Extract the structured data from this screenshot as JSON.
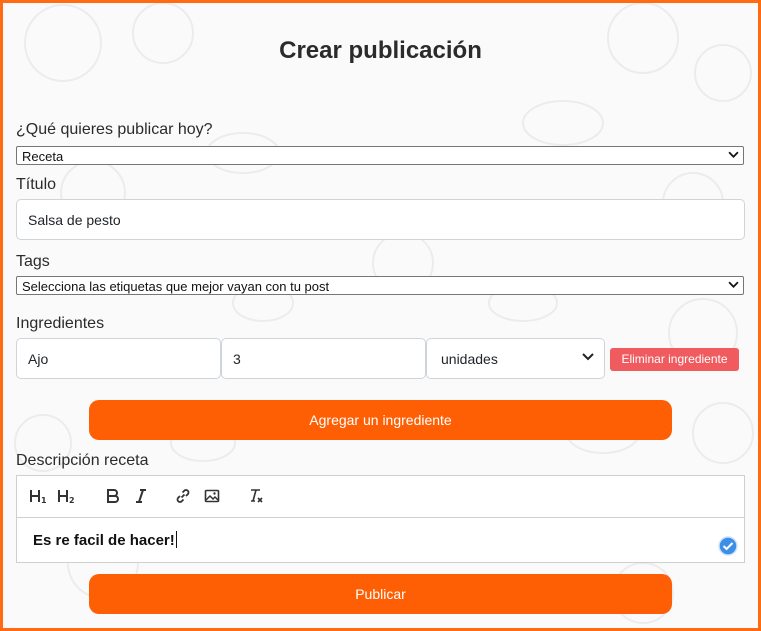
{
  "page": {
    "title": "Crear publicación"
  },
  "post_type": {
    "label": "¿Qué quieres publicar hoy?",
    "selected": "Receta"
  },
  "title_field": {
    "label": "Título",
    "value": "Salsa de pesto"
  },
  "tags": {
    "label": "Tags",
    "selected": "Selecciona las etiquetas que mejor vayan con tu post"
  },
  "ingredients": {
    "label": "Ingredientes",
    "items": [
      {
        "name": "Ajo",
        "quantity": "3",
        "unit": "unidades",
        "remove_label": "Eliminar ingrediente"
      }
    ],
    "add_label": "Agregar un ingrediente"
  },
  "description": {
    "label": "Descripción receta",
    "text": "Es re facil de hacer!",
    "toolbar": [
      "heading-1",
      "heading-2",
      "bold",
      "italic",
      "link",
      "image",
      "clear-format"
    ]
  },
  "submit": {
    "label": "Publicar"
  },
  "colors": {
    "accent": "#ff5f04",
    "frame": "#ff6a13",
    "danger": "#ef5b5f",
    "check": "#3b8fe8"
  }
}
